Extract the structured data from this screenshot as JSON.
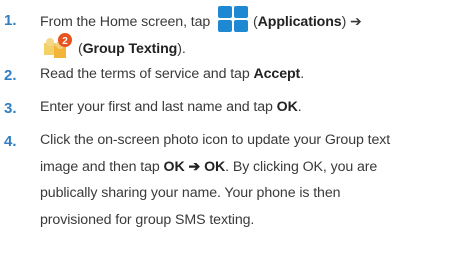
{
  "steps": [
    {
      "number": "1.",
      "lines": [
        {
          "pre": "From the Home screen, tap ",
          "icon": "applications-icon",
          "paren_open": "(",
          "bold": "Applications",
          "paren_close": ") ➔"
        },
        {
          "icon": "group-texting-icon",
          "badge": "2",
          "paren_open": "(",
          "bold": "Group Texting",
          "paren_close": ")."
        }
      ]
    },
    {
      "number": "2.",
      "lines": [
        {
          "pre": "Read the terms of service and tap ",
          "bold": "Accept",
          "post": "."
        }
      ]
    },
    {
      "number": "3.",
      "lines": [
        {
          "pre": "Enter your first and last name and tap ",
          "bold": "OK",
          "post": "."
        }
      ]
    },
    {
      "number": "4.",
      "lines": [
        {
          "text": "Click the on-screen photo icon to update your Group text"
        },
        {
          "pre": "image and then tap ",
          "bold": "OK ➔ OK",
          "post": ". By clicking OK, you are"
        },
        {
          "text": "publically sharing your name. Your phone is then"
        },
        {
          "text": "provisioned for group SMS texting."
        }
      ]
    }
  ],
  "colors": {
    "number": "#2f7fc1",
    "icon_blue": "#1e88d2",
    "badge": "#e8531e"
  }
}
